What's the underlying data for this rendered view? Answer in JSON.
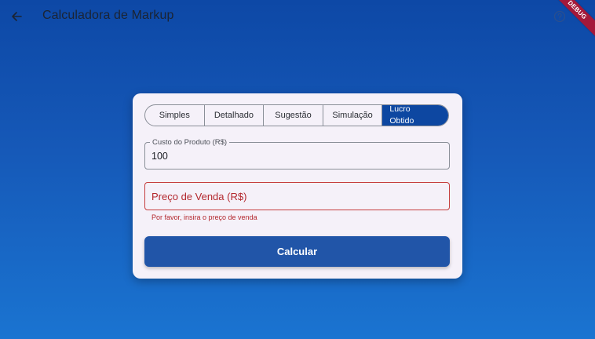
{
  "appbar": {
    "title": "Calculadora de Markup",
    "back_icon": "arrow-left-icon",
    "help_icon": "help-circle-icon",
    "debug_banner": "DEBUG"
  },
  "tabs": [
    {
      "label": "Simples",
      "active": false
    },
    {
      "label": "Detalhado",
      "active": false
    },
    {
      "label": "Sugestão",
      "active": false
    },
    {
      "label": "Simulação",
      "active": false
    },
    {
      "label": "Lucro Obtido",
      "active": true
    }
  ],
  "form": {
    "cost_label": "Custo do Produto (R$)",
    "cost_value": "100",
    "price_placeholder": "Preço de Venda (R$)",
    "price_value": "",
    "price_error": "Por favor, insira o preço de venda",
    "submit_label": "Calcular"
  },
  "colors": {
    "background_top": "#0d48a6",
    "background_bottom": "#1a74d1",
    "card": "#f5f1f9",
    "active_tab": "#0d47a1",
    "error": "#b3272d",
    "button": "#2155a8",
    "debug_banner": "#a4183a"
  }
}
